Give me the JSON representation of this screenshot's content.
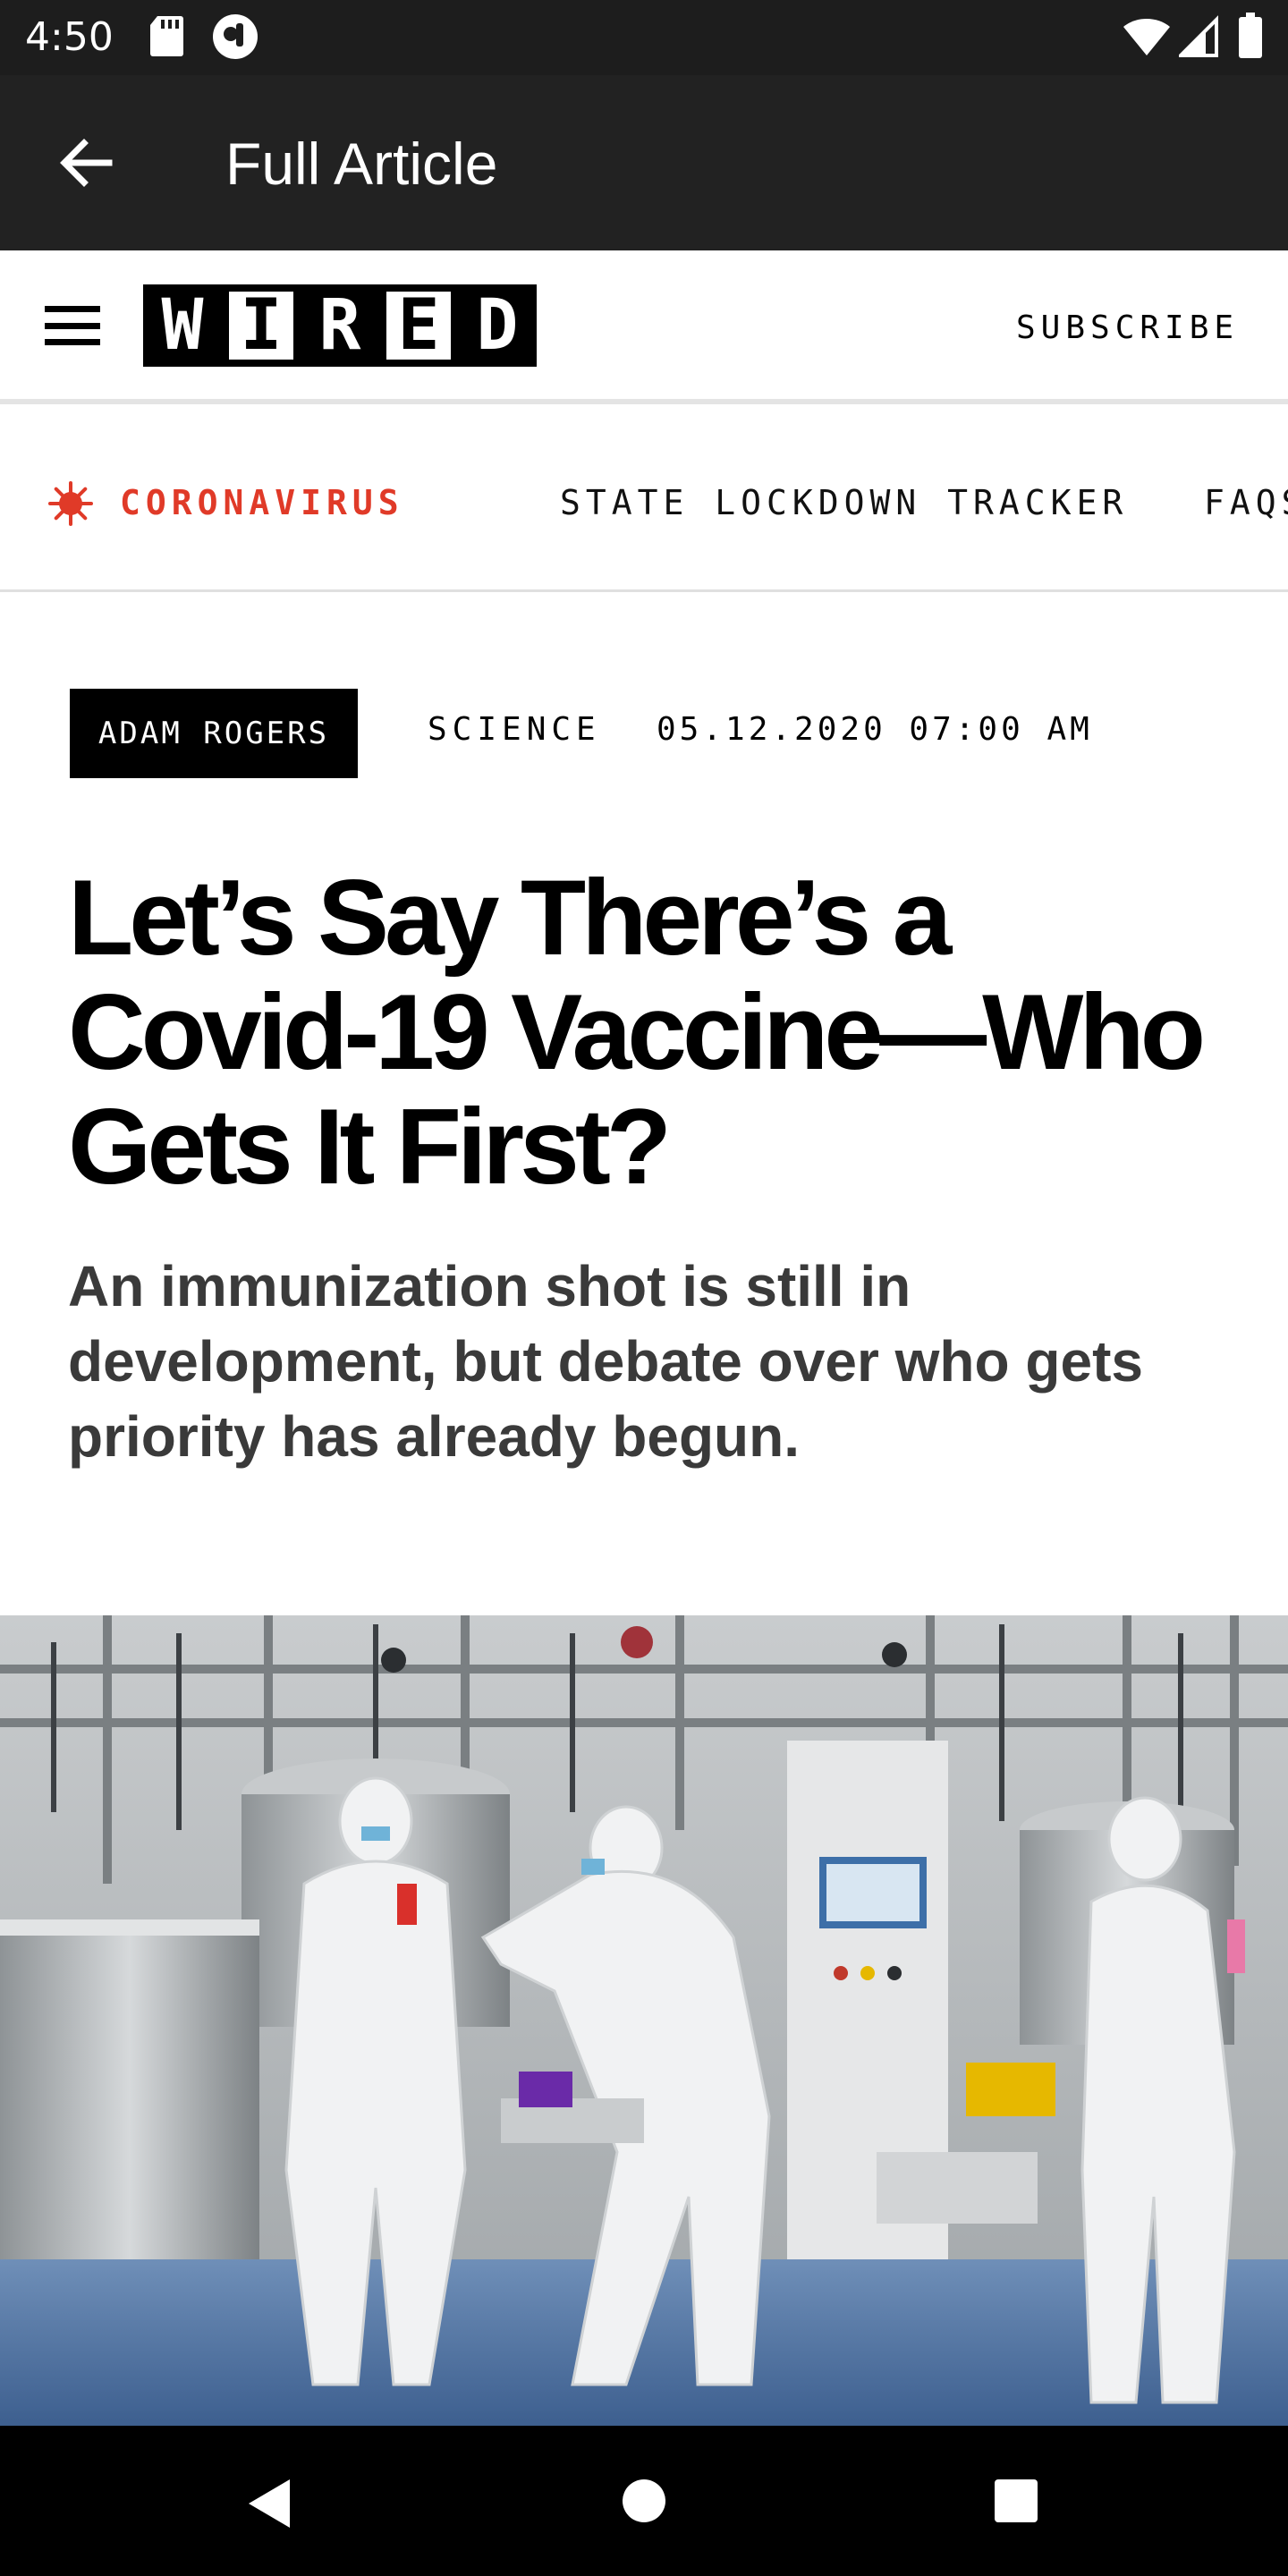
{
  "status_bar": {
    "time": "4:50",
    "icons": [
      "sd-card-icon",
      "vpn-icon",
      "wifi-icon",
      "cell-signal-icon",
      "battery-icon"
    ]
  },
  "app_bar": {
    "title": "Full Article",
    "back_icon": "arrow-left-icon"
  },
  "site_header": {
    "menu_icon": "hamburger-menu-icon",
    "logo_letters": [
      "W",
      "I",
      "R",
      "E",
      "D"
    ],
    "subscribe_label": "SUBSCRIBE"
  },
  "nav_strip": {
    "topic_icon": "virus-icon",
    "topic_color": "#e03a28",
    "items": [
      "CORONAVIRUS",
      "STATE LOCKDOWN TRACKER",
      "FAQS"
    ]
  },
  "article": {
    "author": "ADAM ROGERS",
    "section": "SCIENCE",
    "date": "05.12.2020 07:00 AM",
    "headline": "Let’s Say There’s a Covid-19 Vaccine—Who Gets It First?",
    "dek": "An immunization shot is still in development, but debate over who gets priority has already begun."
  },
  "system_nav": {
    "icons": [
      "back-triangle-icon",
      "home-circle-icon",
      "recents-square-icon"
    ]
  }
}
